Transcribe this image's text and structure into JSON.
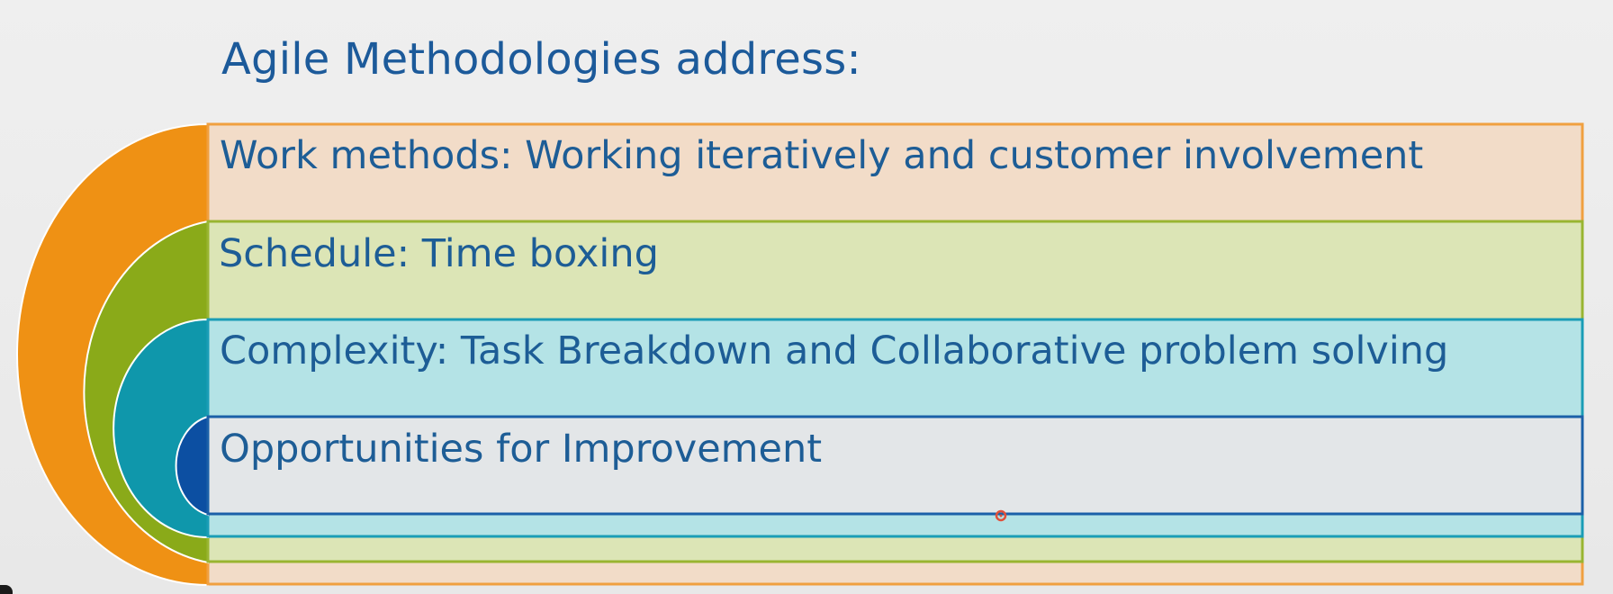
{
  "title": "Agile Methodologies address:",
  "layers": [
    {
      "label": "Work methods: Working iteratively and customer involvement",
      "fill": "#f2dcc8",
      "border": "#f0a040",
      "arc": "#ef9114"
    },
    {
      "label": "Schedule: Time boxing",
      "fill": "#dce5b6",
      "border": "#99b531",
      "arc": "#8aaa19"
    },
    {
      "label": "Complexity: Task Breakdown and Collaborative problem solving",
      "fill": "#b4e3e6",
      "border": "#1a9db6",
      "arc": "#0f97ab"
    },
    {
      "label": "Opportunities for Improvement",
      "fill": "#e3e6e8",
      "border": "#1b60a8",
      "arc": "#0c4fa2"
    }
  ]
}
